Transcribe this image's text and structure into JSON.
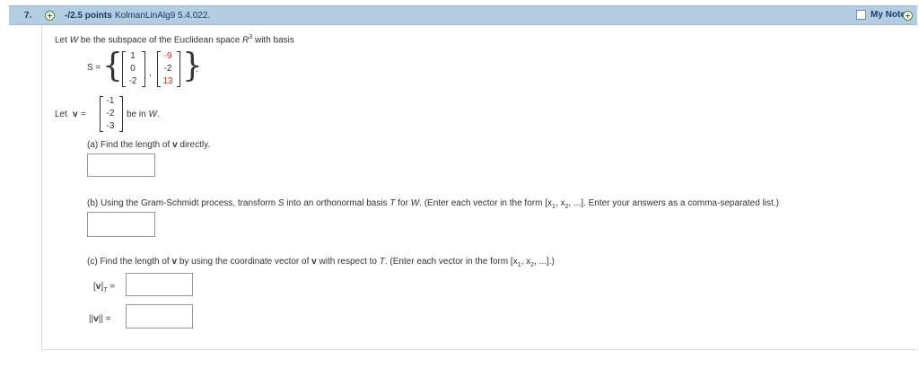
{
  "header": {
    "question_number": "7.",
    "points": "-/2.5 points",
    "source": "KolmanLinAlg9 5.4.022.",
    "my_notes": "My Notes"
  },
  "problem": {
    "intro_pre": "Let ",
    "intro_W": "W",
    "intro_mid": " be the subspace of the Euclidean space ",
    "intro_R": "R",
    "intro_exp": "3",
    "intro_post": " with basis",
    "basis_label": "S =",
    "basis_v1": [
      "1",
      "0",
      "-2"
    ],
    "basis_v2": [
      "-9",
      "-2",
      "13"
    ],
    "basis_comma": ",",
    "basis_period": ".",
    "let_label": "Let",
    "v_label": "v",
    "equals": "=",
    "v_vec": [
      "-1",
      "-2",
      "-3"
    ],
    "be_in": "be in ",
    "be_in_W": "W",
    "be_in_period": "."
  },
  "part_a": {
    "text_pre": "(a) Find the length of ",
    "text_v": "v",
    "text_post": " directly."
  },
  "part_b": {
    "text_pre": "(b) Using the Gram-Schmidt process, transform ",
    "S": "S",
    "text_mid": " into an orthonormal basis ",
    "T": "T",
    "text_mid2": " for ",
    "W": "W",
    "text_post": ". (Enter each vector in the form [x",
    "sub1": "1",
    "comma": ", x",
    "sub2": "2",
    "text_end": ", ...]. Enter your answers as a comma-separated list.)"
  },
  "part_c": {
    "text_pre": "(c) Find the length of ",
    "v1": "v",
    "text_mid": " by using the coordinate vector of ",
    "v2": "v",
    "text_mid2": " with respect to ",
    "T": "T",
    "text_post": ". (Enter each vector in the form [x",
    "sub1": "1",
    "comma": ", x",
    "sub2": "2",
    "text_end": ", ...].)",
    "coord_label_open": "[",
    "coord_label_v": "v",
    "coord_label_close": "]",
    "coord_label_sub": "T",
    "coord_eq": "=",
    "norm_label_open": "||",
    "norm_label_v": "v",
    "norm_label_close": "||",
    "norm_eq": "="
  },
  "colors": {
    "header_bg": "#b5cde3",
    "accent_red": "#c0392b",
    "header_text": "#1a3a66"
  }
}
